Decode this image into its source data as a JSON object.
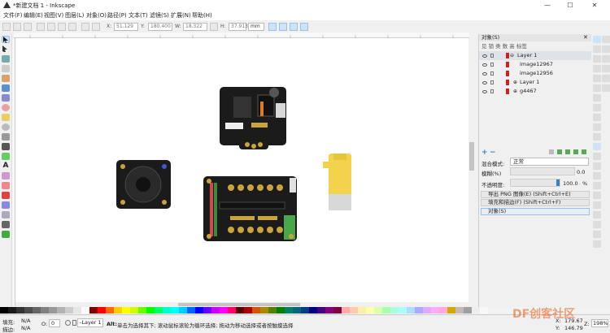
{
  "window": {
    "title": "*新建文档 1 - Inkscape",
    "minimize": "—",
    "maximize": "☐",
    "close": "✕"
  },
  "menu": [
    "文件(F)",
    "编辑(E)",
    "视图(V)",
    "图层(L)",
    "对象(O)",
    "路径(P)",
    "文本(T)",
    "滤镜(S)",
    "扩展(N)",
    "帮助(H)"
  ],
  "tool_controls": {
    "x_label": "X:",
    "x_value": "51.129",
    "y_label": "Y:",
    "y_value": "180.400",
    "w_label": "W:",
    "w_value": "18.322",
    "h_label": "H:",
    "h_value": "37.913",
    "unit": "mm"
  },
  "panel": {
    "title": "对象(S)",
    "columns": "见 锁 类 数 高 标签",
    "layers": [
      {
        "label": "Layer 1",
        "indent": 0,
        "selected": true
      },
      {
        "label": "image12967",
        "indent": 1
      },
      {
        "label": "image12956",
        "indent": 1
      },
      {
        "label": "Layer 1",
        "indent": 1,
        "expand": "⊕"
      },
      {
        "label": "g4467",
        "indent": 1,
        "expand": "⊕"
      }
    ],
    "blend_label": "混合模式:",
    "blend_value": "正常",
    "blur_label": "模糊(%)",
    "blur_value": "0.0",
    "opacity_label": "不透明度:",
    "opacity_value": "100.0",
    "opacity_pct": "%",
    "sections": [
      "导出 PNG 图像(E) (Shift+Ctrl+E)",
      "填充和描边(F) (Shift+Ctrl+F)",
      "对象(S)"
    ]
  },
  "status": {
    "fill_label": "填充:",
    "fill_value": "N/A",
    "stroke_label": "描边:",
    "stroke_value": "N/A",
    "opacity_label": "O:",
    "opacity_value": "0",
    "layer_value": "-Layer 1",
    "message_bold": "Alt:",
    "message": " 单击为选择其下; 滚动鼠标滚轮为循环选择; 拖动为移动选择或者按触摸选择",
    "x_label": "X:",
    "x_value": "179.67",
    "y_label": "Y:",
    "y_value": "146.79",
    "z_label": "Z:",
    "zoom_value": "198%",
    "watermark": "DF创客社区"
  },
  "colors": {
    "accent": "#3b82c4",
    "pcb_black": "#1b1b1b",
    "gold": "#c9a43a",
    "motor_yellow": "#f2d34b"
  }
}
